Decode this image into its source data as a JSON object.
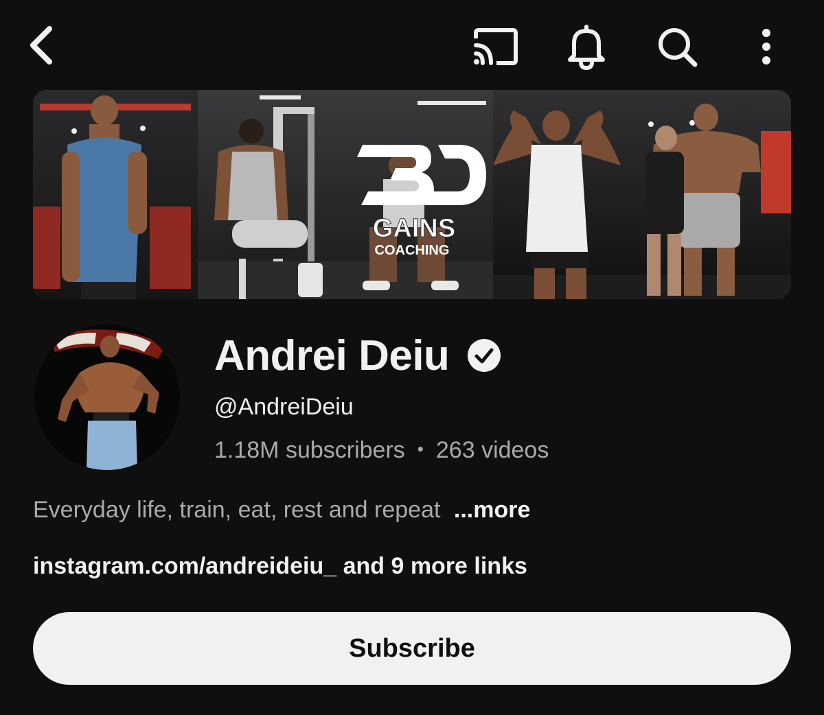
{
  "header": {
    "back_icon": "chevron-left-icon",
    "actions": [
      "cast-icon",
      "bell-icon",
      "search-icon",
      "more-vertical-icon"
    ]
  },
  "banner": {
    "logo_text": "GAINS",
    "logo_subtext": "COACHING"
  },
  "channel": {
    "name": "Andrei Deiu",
    "verified": true,
    "handle": "@AndreiDeiu",
    "subscribers": "1.18M subscribers",
    "separator": "•",
    "videos": "263 videos",
    "description": "Everyday life, train, eat, rest and repeat",
    "more_label": "...more",
    "links": "instagram.com/andreideiu_ and 9 more links"
  },
  "actions": {
    "subscribe_label": "Subscribe"
  },
  "colors": {
    "background": "#0f0f0f",
    "text_primary": "#f1f1f1",
    "text_secondary": "#aaaaaa",
    "subscribe_bg": "#f1f1f1",
    "subscribe_text": "#0f0f0f"
  }
}
